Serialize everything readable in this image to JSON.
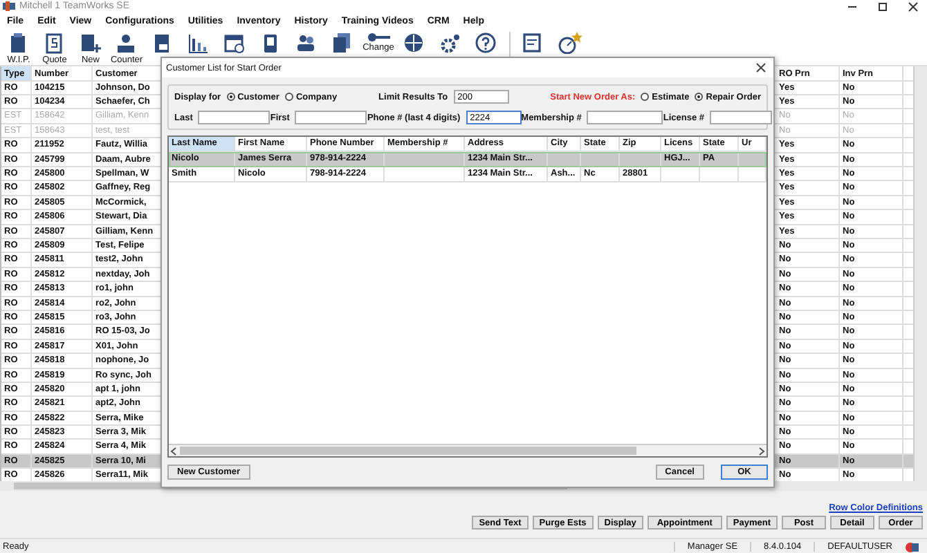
{
  "window": {
    "title": "Mitchell 1 TeamWorks SE"
  },
  "menu": [
    "File",
    "Edit",
    "View",
    "Configurations",
    "Utilities",
    "Inventory",
    "History",
    "Training Videos",
    "CRM",
    "Help"
  ],
  "toolbar": [
    {
      "kind": "labeled",
      "label": "W.I.P."
    },
    {
      "kind": "labeled",
      "label": "Quote"
    },
    {
      "kind": "labeled",
      "label": "New"
    },
    {
      "kind": "labeled",
      "label": "Counter"
    },
    {
      "kind": "icon"
    },
    {
      "kind": "icon"
    },
    {
      "kind": "icon"
    },
    {
      "kind": "icon"
    },
    {
      "kind": "icon"
    },
    {
      "kind": "icon"
    },
    {
      "kind": "labeled",
      "label": "Change"
    },
    {
      "kind": "icon"
    },
    {
      "kind": "icon"
    },
    {
      "kind": "icon"
    },
    {
      "kind": "icon"
    },
    {
      "kind": "icon"
    }
  ],
  "table": {
    "columns": [
      "Type",
      "Number",
      "Customer",
      "RO Prn",
      "Inv Prn"
    ],
    "rows": [
      {
        "type": "RO",
        "number": "104215",
        "customer": "Johnson, Do",
        "ro_prn": "Yes",
        "inv_prn": "No",
        "dimmed": false,
        "selected": false
      },
      {
        "type": "RO",
        "number": "104234",
        "customer": "Schaefer, Ch",
        "ro_prn": "Yes",
        "inv_prn": "No",
        "dimmed": false,
        "selected": false
      },
      {
        "type": "EST",
        "number": "158642",
        "customer": "Gilliam, Kenn",
        "ro_prn": "No",
        "inv_prn": "No",
        "dimmed": true,
        "selected": false
      },
      {
        "type": "EST",
        "number": "158643",
        "customer": "test, test",
        "ro_prn": "No",
        "inv_prn": "No",
        "dimmed": true,
        "selected": false
      },
      {
        "type": "RO",
        "number": "211952",
        "customer": "Fautz, Willia",
        "ro_prn": "Yes",
        "inv_prn": "No",
        "dimmed": false,
        "selected": false
      },
      {
        "type": "RO",
        "number": "245799",
        "customer": "Daam, Aubre",
        "ro_prn": "Yes",
        "inv_prn": "No",
        "dimmed": false,
        "selected": false
      },
      {
        "type": "RO",
        "number": "245800",
        "customer": "Spellman, W",
        "ro_prn": "Yes",
        "inv_prn": "No",
        "dimmed": false,
        "selected": false
      },
      {
        "type": "RO",
        "number": "245802",
        "customer": "Gaffney, Reg",
        "ro_prn": "Yes",
        "inv_prn": "No",
        "dimmed": false,
        "selected": false
      },
      {
        "type": "RO",
        "number": "245805",
        "customer": "McCormick,",
        "ro_prn": "Yes",
        "inv_prn": "No",
        "dimmed": false,
        "selected": false
      },
      {
        "type": "RO",
        "number": "245806",
        "customer": "Stewart, Dia",
        "ro_prn": "Yes",
        "inv_prn": "No",
        "dimmed": false,
        "selected": false
      },
      {
        "type": "RO",
        "number": "245807",
        "customer": "Gilliam, Kenn",
        "ro_prn": "Yes",
        "inv_prn": "No",
        "dimmed": false,
        "selected": false
      },
      {
        "type": "RO",
        "number": "245809",
        "customer": "Test, Felipe",
        "ro_prn": "No",
        "inv_prn": "No",
        "dimmed": false,
        "selected": false
      },
      {
        "type": "RO",
        "number": "245811",
        "customer": "test2, John",
        "ro_prn": "No",
        "inv_prn": "No",
        "dimmed": false,
        "selected": false
      },
      {
        "type": "RO",
        "number": "245812",
        "customer": "nextday, Joh",
        "ro_prn": "No",
        "inv_prn": "No",
        "dimmed": false,
        "selected": false
      },
      {
        "type": "RO",
        "number": "245813",
        "customer": "ro1, john",
        "ro_prn": "No",
        "inv_prn": "No",
        "dimmed": false,
        "selected": false
      },
      {
        "type": "RO",
        "number": "245814",
        "customer": "ro2, John",
        "ro_prn": "No",
        "inv_prn": "No",
        "dimmed": false,
        "selected": false
      },
      {
        "type": "RO",
        "number": "245815",
        "customer": "ro3, John",
        "ro_prn": "No",
        "inv_prn": "No",
        "dimmed": false,
        "selected": false
      },
      {
        "type": "RO",
        "number": "245816",
        "customer": "RO 15-03, Jo",
        "ro_prn": "No",
        "inv_prn": "No",
        "dimmed": false,
        "selected": false
      },
      {
        "type": "RO",
        "number": "245817",
        "customer": "X01, John",
        "ro_prn": "No",
        "inv_prn": "No",
        "dimmed": false,
        "selected": false
      },
      {
        "type": "RO",
        "number": "245818",
        "customer": "nophone, Jo",
        "ro_prn": "No",
        "inv_prn": "No",
        "dimmed": false,
        "selected": false
      },
      {
        "type": "RO",
        "number": "245819",
        "customer": "Ro sync, Joh",
        "ro_prn": "No",
        "inv_prn": "No",
        "dimmed": false,
        "selected": false
      },
      {
        "type": "RO",
        "number": "245820",
        "customer": "apt 1, john",
        "ro_prn": "No",
        "inv_prn": "No",
        "dimmed": false,
        "selected": false
      },
      {
        "type": "RO",
        "number": "245821",
        "customer": "apt2, John",
        "ro_prn": "No",
        "inv_prn": "No",
        "dimmed": false,
        "selected": false
      },
      {
        "type": "RO",
        "number": "245822",
        "customer": "Serra, Mike",
        "ro_prn": "No",
        "inv_prn": "No",
        "dimmed": false,
        "selected": false
      },
      {
        "type": "RO",
        "number": "245823",
        "customer": "Serra 3, Mik",
        "ro_prn": "No",
        "inv_prn": "No",
        "dimmed": false,
        "selected": false
      },
      {
        "type": "RO",
        "number": "245824",
        "customer": "Serra 4, Mik",
        "ro_prn": "No",
        "inv_prn": "No",
        "dimmed": false,
        "selected": false
      },
      {
        "type": "RO",
        "number": "245825",
        "customer": "Serra 10, Mi",
        "ro_prn": "No",
        "inv_prn": "No",
        "dimmed": false,
        "selected": true
      },
      {
        "type": "RO",
        "number": "245826",
        "customer": "Serra11, Mik",
        "ro_prn": "No",
        "inv_prn": "No",
        "dimmed": false,
        "selected": false
      }
    ]
  },
  "dialog": {
    "title": "Customer List for Start Order",
    "display_for": {
      "label": "Display for",
      "options": [
        {
          "label": "Customer",
          "selected": true
        },
        {
          "label": "Company",
          "selected": false
        }
      ]
    },
    "limit": {
      "label": "Limit Results To",
      "value": "200"
    },
    "start_as": {
      "label": "Start New Order As:",
      "options": [
        {
          "label": "Estimate",
          "selected": false
        },
        {
          "label": "Repair Order",
          "selected": true
        }
      ]
    },
    "filters": [
      {
        "label": "Last"
      },
      {
        "label": "First"
      },
      {
        "label": "Phone # (last 4 digits)",
        "value": "2224"
      },
      {
        "label": "Membership #"
      },
      {
        "label": "License #"
      }
    ],
    "grid": {
      "columns": [
        "Last Name",
        "First Name",
        "Phone Number",
        "Membership #",
        "Address",
        "City",
        "State",
        "Zip",
        "Licens",
        "State",
        "Ur"
      ],
      "rows": [
        {
          "cells": [
            "Nicolo",
            "James Serra",
            "978-914-2224",
            "",
            "1234 Main Str...",
            "",
            "",
            "",
            "HGJ...",
            "PA",
            ""
          ],
          "selected": true
        },
        {
          "cells": [
            "Smith",
            "Nicolo",
            "798-914-2224",
            "",
            "1234 Main Str...",
            "Ash...",
            "Nc",
            "28801",
            "",
            "",
            ""
          ],
          "selected": false
        }
      ]
    },
    "buttons": {
      "new": "New Customer",
      "cancel": "Cancel",
      "ok": "OK"
    }
  },
  "link": "Row Color Definitions",
  "actions": [
    "Send Text",
    "Purge Ests",
    "Display",
    "Appointment",
    "Payment",
    "Post",
    "Detail",
    "Order"
  ],
  "status_bar": {
    "state": "Ready",
    "role": "Manager SE",
    "version": "8.4.0.104",
    "user": "DEFAULTUSER"
  }
}
